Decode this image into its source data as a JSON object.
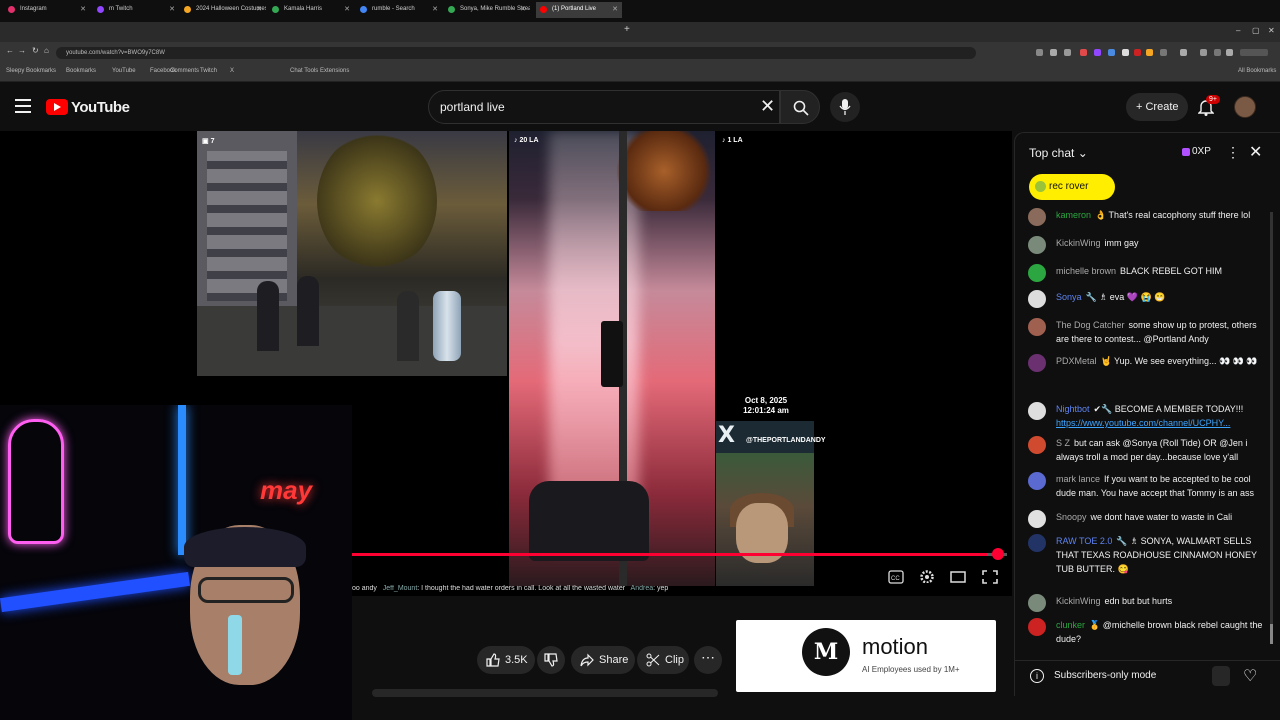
{
  "browser": {
    "tabs": [
      {
        "title": "Instagram",
        "color": "#e1306c"
      },
      {
        "title": "m Twitch",
        "color": "#9146ff"
      },
      {
        "title": "2024 Halloween Costumes: Trends",
        "color": "#f5a623"
      },
      {
        "title": "Kamala Harris",
        "color": "#34a853"
      },
      {
        "title": "rumble - Search",
        "color": "#4285f4"
      },
      {
        "title": "Sonya, Mike Rumble Stream",
        "color": "#34a853"
      },
      {
        "title": "(1) Portland Live",
        "color": "#ff0000"
      }
    ],
    "url": "youtube.com/watch?v=BWO9y7C8W",
    "bookmarks": [
      "Sleepy Bookmarks",
      "Bookmarks",
      "YouTube",
      "Facebook",
      "Comments",
      "Twitch",
      "X",
      "Chat Tools",
      "Extensions"
    ],
    "all_bookmarks": "All Bookmarks"
  },
  "header": {
    "logo_text": "YouTube",
    "search_value": "portland live",
    "create_label": "Create",
    "notif_count": "9+"
  },
  "player": {
    "viewers_label": "7",
    "scene2_label": "20 LA",
    "scene3_label": "1 LA",
    "timestamp_date": "Oct 8, 2025",
    "timestamp_time": "12:01:24 am",
    "x_handle": "@THEPORTLANDANDY",
    "neon_text": "may",
    "ticker_pre": "oo andy",
    "ticker_name1": "Jeff_Mount",
    "ticker_msg1": ": I thought the had water orders in call. Look at all the wasted water",
    "ticker_name2": "Andrea",
    "ticker_msg2": ": yep",
    "progress": 0.97
  },
  "actions": {
    "likes": "3.5K",
    "share_label": "Share",
    "clip_label": "Clip"
  },
  "ad": {
    "logo": "M",
    "title": "motion",
    "subtitle": "AI Employees used by 1M+"
  },
  "chat": {
    "header_title": "Top chat",
    "points": "0XP",
    "pinned_name": "rec rover",
    "messages": [
      {
        "author": "kameron",
        "text": "👌 That's real cacophony stuff there lol",
        "av": "#8a6a5a",
        "cls": "mem"
      },
      {
        "author": "KickinWing",
        "text": "imm gay",
        "av": "#7a8a7a",
        "cls": ""
      },
      {
        "author": "michelle brown",
        "text": "BLACK REBEL GOT HIM",
        "av": "#2ba640",
        "cls": ""
      },
      {
        "author": "Sonya",
        "text": "🔧 ♗ eva 💜 😭 😁",
        "av": "#dddddd",
        "cls": "mod"
      },
      {
        "author": "The Dog Catcher",
        "text": "some show up to protest, others are there to contest... @Portland Andy",
        "av": "#a06050",
        "cls": ""
      },
      {
        "author": "PDXMetal",
        "text": "🤘 Yup. We see everything... 👀 👀 👀",
        "av": "#6a3070",
        "cls": ""
      },
      {
        "author": "Nightbot",
        "text": "✔🔧 BECOME A MEMBER TODAY!!!",
        "link": "https://www.youtube.com/channel/UCPHY...",
        "av": "#dddddd",
        "cls": "mod"
      },
      {
        "author": "S Z",
        "text": "but can ask @Sonya (Roll Tide) OR @Jen i always troll a mod per day...because love y'all",
        "av": "#d04a30",
        "cls": ""
      },
      {
        "author": "mark lance",
        "text": "If you want to be accepted to be cool dude man. You have accept that Tommy is an ass",
        "av": "#5a6ad0",
        "cls": ""
      },
      {
        "author": "Snoopy",
        "text": "we dont have water to waste in Cali",
        "av": "#e0e0e0",
        "cls": ""
      },
      {
        "author": "RAW TOE 2.0",
        "text": "🔧 ♗ SONYA, WALMART SELLS THAT TEXAS ROADHOUSE CINNAMON HONEY TUB BUTTER. 😋",
        "av": "#223366",
        "cls": "mod"
      },
      {
        "author": "KickinWing",
        "text": "edn but but hurts",
        "av": "#7a8a7a",
        "cls": ""
      },
      {
        "author": "clunker",
        "text": "🥇 @michelle brown black rebel caught the dude?",
        "av": "#cc2222",
        "cls": "mem"
      }
    ],
    "footer_text": "Subscribers-only mode"
  }
}
